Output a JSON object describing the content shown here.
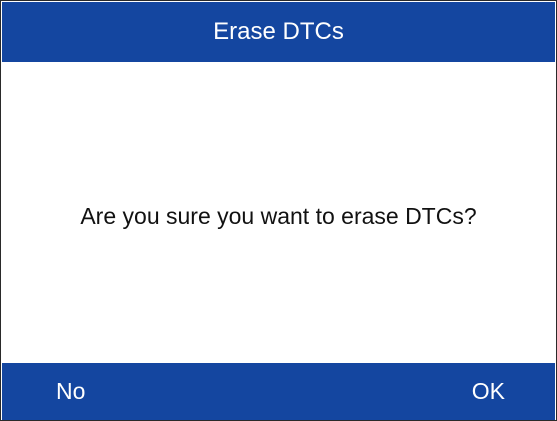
{
  "window": {
    "title": "Erase DTCs"
  },
  "dialog": {
    "message": "Are you sure you want to erase DTCs?"
  },
  "footer": {
    "no_label": "No",
    "ok_label": "OK"
  },
  "colors": {
    "bar_background": "#1446a0",
    "bar_text": "#ffffff",
    "body_background": "#ffffff",
    "body_text": "#111111"
  }
}
